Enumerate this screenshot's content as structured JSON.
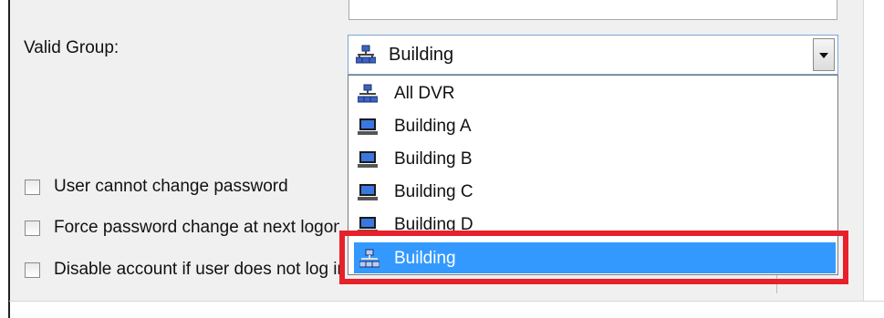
{
  "form": {
    "valid_group_label": "Valid Group:",
    "selected_value": "Building",
    "options": [
      {
        "label": "All DVR",
        "icon": "network-group-icon"
      },
      {
        "label": "Building A",
        "icon": "dvr-computer-icon"
      },
      {
        "label": "Building B",
        "icon": "dvr-computer-icon"
      },
      {
        "label": "Building C",
        "icon": "dvr-computer-icon"
      },
      {
        "label": "Building D",
        "icon": "dvr-computer-icon"
      },
      {
        "label": "Building",
        "icon": "network-group-icon",
        "selected": true
      }
    ],
    "checkboxes": [
      {
        "label": "User cannot change password",
        "checked": false
      },
      {
        "label": "Force password change at next logon",
        "checked": false
      },
      {
        "label": "Disable account if user does not log in within",
        "checked": false
      }
    ]
  },
  "colors": {
    "selection": "#3399ff",
    "highlight": "#e8202a",
    "panel": "#f0f0f0"
  }
}
